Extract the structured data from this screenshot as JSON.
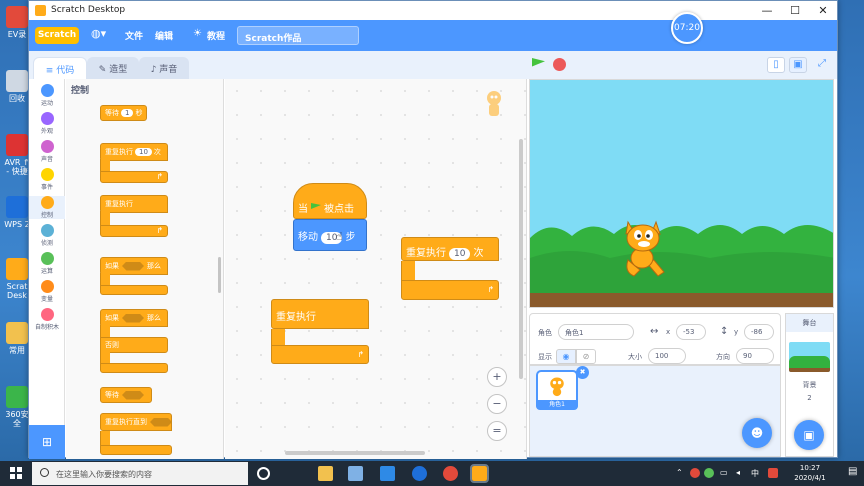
{
  "desktop_icons": [
    {
      "label": "EV录"
    },
    {
      "label": "回收"
    },
    {
      "label": "AVR_fi - 快捷"
    },
    {
      "label": "WPS 2"
    },
    {
      "label": "Scrat Desk"
    },
    {
      "label": "常用"
    },
    {
      "label": "360安全"
    }
  ],
  "window": {
    "title": "Scratch Desktop",
    "minimize": "—",
    "maximize": "☐",
    "close": "✕"
  },
  "menubar": {
    "logo": "Scratch",
    "file": "文件",
    "edit": "编辑",
    "tutorial": "教程",
    "project_title": "Scratch作品",
    "timer": "07:20"
  },
  "tabs": {
    "code": "代码",
    "costumes": "造型",
    "sounds": "声音"
  },
  "categories": [
    {
      "label": "运动",
      "color": "#4c97ff"
    },
    {
      "label": "外观",
      "color": "#9966ff"
    },
    {
      "label": "声音",
      "color": "#cf63cf"
    },
    {
      "label": "事件",
      "color": "#ffd500"
    },
    {
      "label": "控制",
      "color": "#ffab19"
    },
    {
      "label": "侦测",
      "color": "#5cb1d6"
    },
    {
      "label": "运算",
      "color": "#59c059"
    },
    {
      "label": "变量",
      "color": "#ff8c1a"
    },
    {
      "label": "自制积木",
      "color": "#ff6680"
    }
  ],
  "palette": {
    "title": "控制",
    "wait": {
      "pre": "等待",
      "value": "1",
      "post": "秒"
    },
    "repeat": {
      "pre": "重复执行",
      "value": "10",
      "post": "次"
    },
    "forever": "重复执行",
    "if_then": {
      "pre": "如果",
      "post": "那么"
    },
    "if_else": {
      "pre": "如果",
      "post": "那么",
      "else": "否则"
    },
    "wait_until": "等待",
    "repeat_until": "重复执行直到"
  },
  "script": {
    "hat": {
      "pre": "当",
      "post": "被点击"
    },
    "move": {
      "pre": "移动",
      "value": "10",
      "post": "步"
    },
    "repeat": {
      "pre": "重复执行",
      "value": "10",
      "post": "次"
    },
    "forever": "重复执行"
  },
  "zoom": {
    "in": "+",
    "out": "−",
    "reset": "="
  },
  "sprite_info": {
    "sprite_label": "角色",
    "sprite_name": "角色1",
    "x_label": "x",
    "x_value": "-53",
    "y_label": "y",
    "y_value": "-86",
    "show_label": "显示",
    "size_label": "大小",
    "size_value": "100",
    "direction_label": "方向",
    "direction_value": "90"
  },
  "sprite_list": {
    "thumb_name": "角色1"
  },
  "stage_pane": {
    "header": "舞台",
    "backdrop_label": "背景",
    "backdrop_count": "2"
  },
  "taskbar": {
    "search_placeholder": "在这里输入你要搜索的内容",
    "ime": "中",
    "time": "10:27",
    "date": "2020/4/1"
  }
}
